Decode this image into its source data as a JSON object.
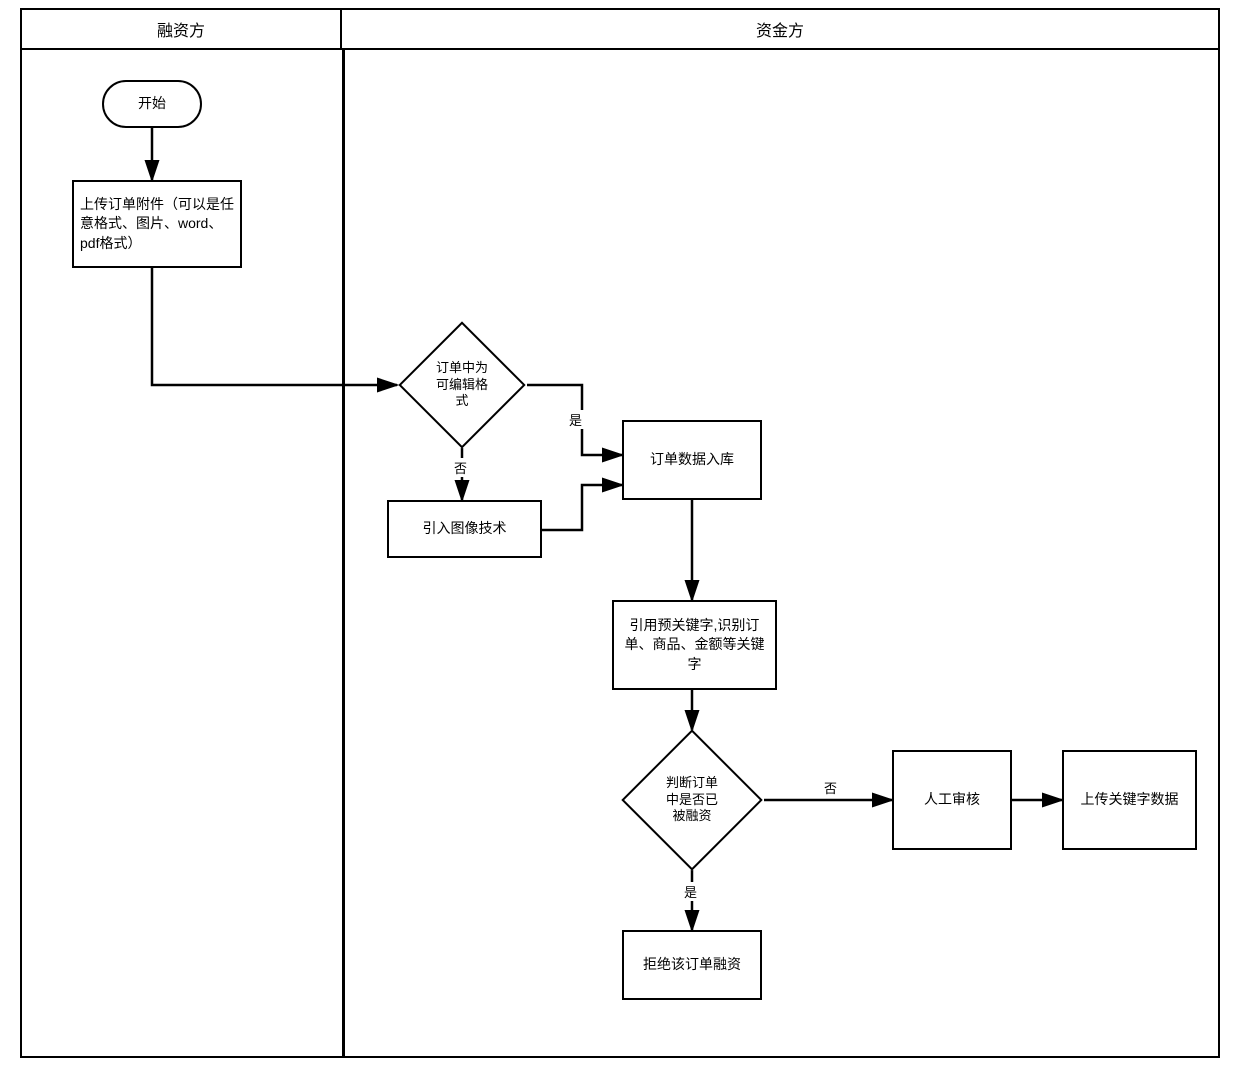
{
  "lanes": {
    "left": "融资方",
    "right": "资金方"
  },
  "nodes": {
    "start": "开始",
    "upload": "上传订单附件（可以是任意格式、图片、word、pdf格式）",
    "decision_format": "订单中为可编辑格式",
    "image_tech": "引入图像技术",
    "data_store": "订单数据入库",
    "keywords": "引用预关键字,识别订单、商品、金额等关键字",
    "decision_financed": "判断订单中是否已被融资",
    "reject": "拒绝该订单融资",
    "manual_review": "人工审核",
    "upload_keywords": "上传关键字数据"
  },
  "edge_labels": {
    "yes": "是",
    "no": "否"
  }
}
